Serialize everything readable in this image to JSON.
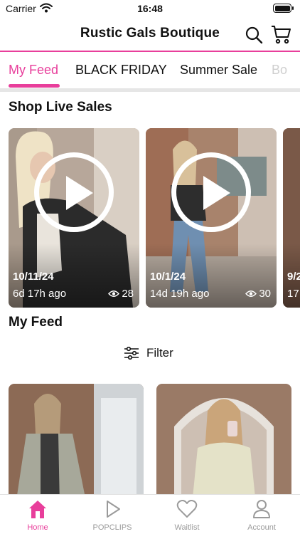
{
  "status_bar": {
    "carrier": "Carrier",
    "time": "16:48"
  },
  "header": {
    "title": "Rustic Gals Boutique",
    "search_icon": "search-icon",
    "cart_icon": "cart-icon"
  },
  "tabs": [
    {
      "label": "My Feed",
      "active": true
    },
    {
      "label": "BLACK FRIDAY",
      "active": false
    },
    {
      "label": "Summer Sale",
      "active": false
    },
    {
      "label": "Bo",
      "active": false
    }
  ],
  "live_section": {
    "title": "Shop Live Sales",
    "cards": [
      {
        "date": "10/11/24",
        "ago": "6d 17h ago",
        "views": "28"
      },
      {
        "date": "10/1/24",
        "ago": "14d 19h ago",
        "views": "30"
      },
      {
        "date": "9/2",
        "ago": "17",
        "views": ""
      }
    ]
  },
  "feed_section": {
    "title": "My Feed",
    "filter_label": "Filter"
  },
  "bottom_nav": [
    {
      "label": "Home",
      "icon": "home-icon",
      "active": true
    },
    {
      "label": "POPCLIPS",
      "icon": "play-icon",
      "active": false
    },
    {
      "label": "Waitlist",
      "icon": "heart-icon",
      "active": false
    },
    {
      "label": "Account",
      "icon": "person-icon",
      "active": false
    }
  ],
  "colors": {
    "accent": "#e83e9b",
    "inactive": "#9a9a9a",
    "divider": "#e6e6e6"
  }
}
